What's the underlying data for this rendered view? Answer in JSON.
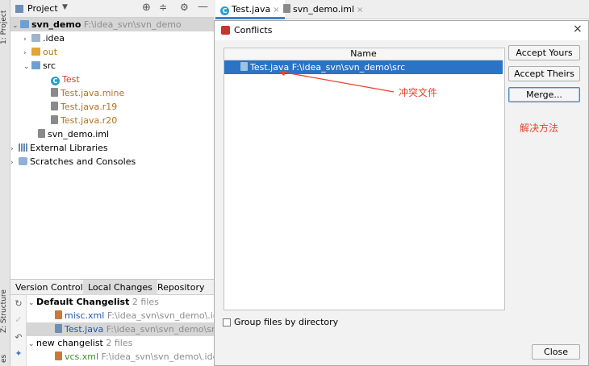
{
  "left_stripe": {
    "project_label": "1: Project",
    "structure_label": "Z: Structure",
    "favorites_label": "es"
  },
  "project_panel": {
    "title": "Project",
    "tree": [
      {
        "label": "svn_demo",
        "path": "F:\\idea_svn\\svn_demo",
        "icon": "folder-icon"
      },
      {
        "label": ".idea",
        "icon": "folder-icon"
      },
      {
        "label": "out",
        "icon": "folder-icon"
      },
      {
        "label": "src",
        "icon": "folder-icon"
      },
      {
        "label": "Test",
        "icon": "class-icon"
      },
      {
        "label": "Test.java.mine",
        "icon": "file-icon"
      },
      {
        "label": "Test.java.r19",
        "icon": "file-icon"
      },
      {
        "label": "Test.java.r20",
        "icon": "file-icon"
      },
      {
        "label": "svn_demo.iml",
        "icon": "file-icon"
      },
      {
        "label": "External Libraries",
        "icon": "library-icon"
      },
      {
        "label": "Scratches and Consoles",
        "icon": "scratches-icon"
      }
    ]
  },
  "version_control": {
    "label": "Version Control:",
    "tabs": [
      "Local Changes",
      "Repository"
    ],
    "changelists": [
      {
        "name": "Default Changelist",
        "count": "2 files",
        "files": [
          {
            "name": "misc.xml",
            "path": "F:\\idea_svn\\svn_demo\\.idea"
          },
          {
            "name": "Test.java",
            "path": "F:\\idea_svn\\svn_demo\\src"
          }
        ]
      },
      {
        "name": "new changelist",
        "count": "2 files",
        "files": [
          {
            "name": "vcs.xml",
            "path": "F:\\idea_svn\\svn_demo\\.idea"
          }
        ]
      }
    ]
  },
  "editor_tabs": [
    {
      "label": "Test.java",
      "icon": "class-icon",
      "active": true
    },
    {
      "label": "svn_demo.iml",
      "icon": "file-icon",
      "active": false
    }
  ],
  "dialog": {
    "title": "Conflicts",
    "column_header": "Name",
    "row": {
      "name": "Test.java",
      "path": "F:\\idea_svn\\svn_demo\\src"
    },
    "buttons": {
      "accept_yours": "Accept Yours",
      "accept_theirs": "Accept Theirs",
      "merge": "Merge...",
      "close": "Close"
    },
    "group_checkbox": "Group files by directory",
    "annotations": {
      "conflict_file": "冲突文件",
      "solution": "解决方法"
    }
  },
  "colors": {
    "selection": "#2a73c5",
    "annotation": "#e8432f",
    "accent": "#4083c9"
  }
}
